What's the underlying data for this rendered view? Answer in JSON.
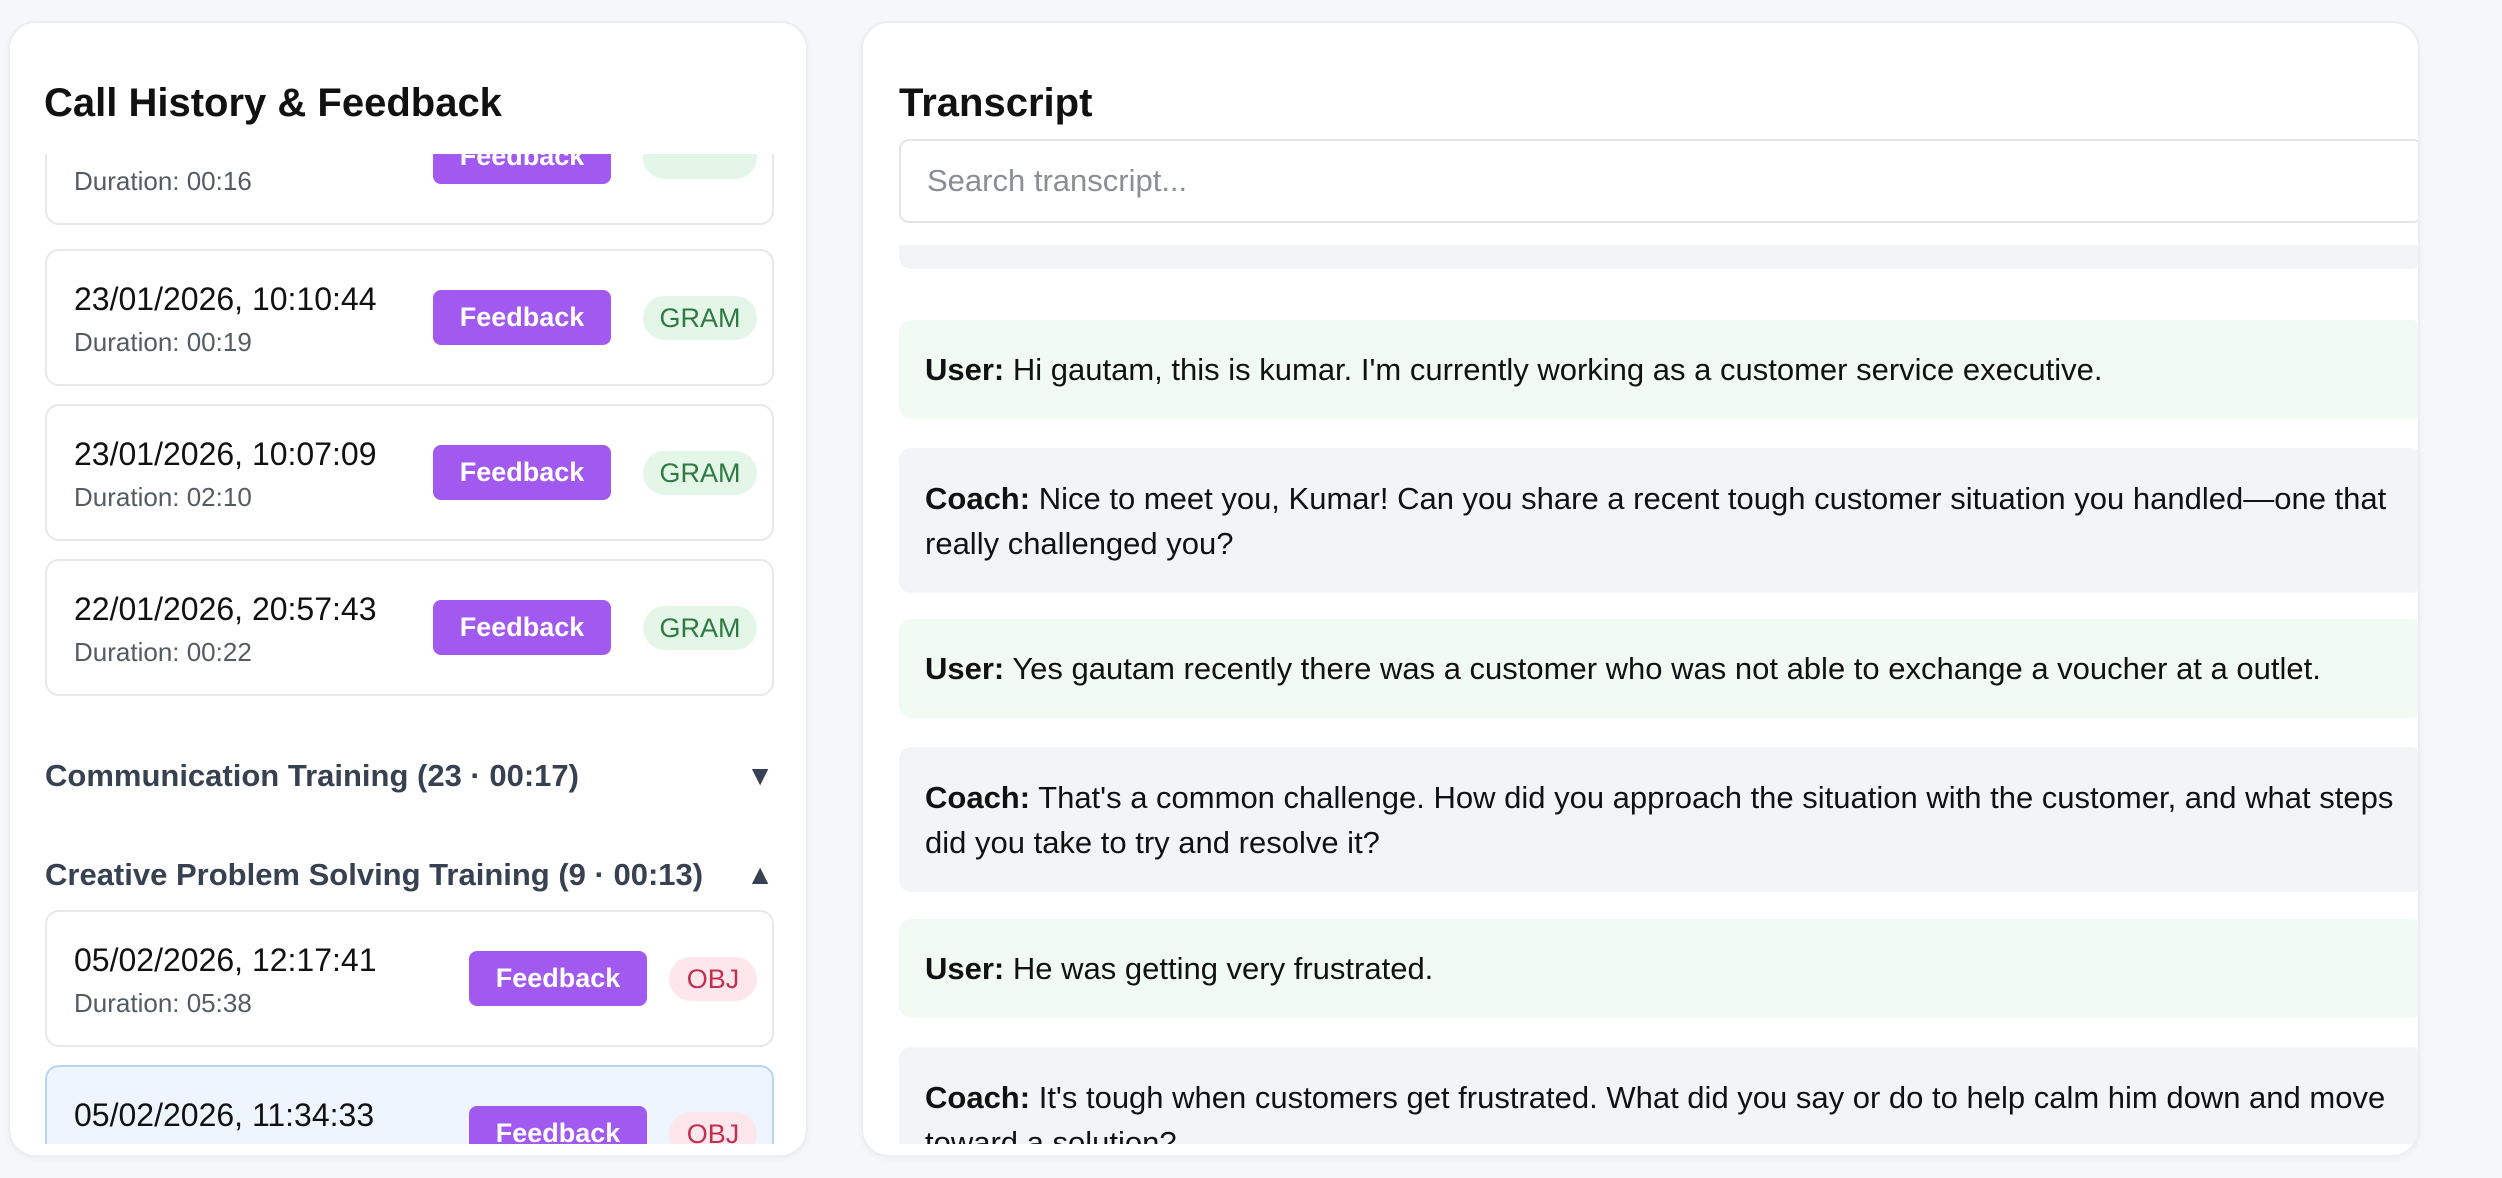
{
  "history": {
    "title": "Call History & Feedback",
    "partial_top_duration": "Duration: 00:16",
    "feedback_label": "Feedback",
    "grammar_calls": [
      {
        "date": "23/01/2026, 10:10:44",
        "duration": "Duration: 00:19",
        "tag": "GRAM"
      },
      {
        "date": "23/01/2026, 10:07:09",
        "duration": "Duration: 02:10",
        "tag": "GRAM"
      },
      {
        "date": "22/01/2026, 20:57:43",
        "duration": "Duration: 00:22",
        "tag": "GRAM"
      }
    ],
    "sections": [
      {
        "title": "Communication Training (23 · 00:17)",
        "chevron": "▼",
        "expanded": false
      },
      {
        "title": "Creative Problem Solving Training (9 · 00:13)",
        "chevron": "▲",
        "expanded": true
      }
    ],
    "creative_calls": [
      {
        "date": "05/02/2026, 12:17:41",
        "duration": "Duration: 05:38",
        "tag": "OBJ",
        "selected": false
      },
      {
        "date": "05/02/2026, 11:34:33",
        "duration": "",
        "tag": "OBJ",
        "selected": true
      }
    ]
  },
  "transcript": {
    "title": "Transcript",
    "search_placeholder": "Search transcript...",
    "messages": [
      {
        "speaker": "User:",
        "text": "Hi gautam, this is kumar. I'm currently working as a customer service executive."
      },
      {
        "speaker": "Coach:",
        "text": "Nice to meet you, Kumar! Can you share a recent tough customer situation you handled—one that really challenged you?"
      },
      {
        "speaker": "User:",
        "text": "Yes gautam recently there was a customer who was not able to exchange a voucher at a outlet."
      },
      {
        "speaker": "Coach:",
        "text": "That's a common challenge. How did you approach the situation with the customer, and what steps did you take to try and resolve it?"
      },
      {
        "speaker": "User:",
        "text": "He was getting very frustrated."
      },
      {
        "speaker": "Coach:",
        "text": "It's tough when customers get frustrated. What did you say or do to help calm him down and move toward a solution?"
      }
    ]
  },
  "colors": {
    "feedback_button": "#a259f0",
    "gram_tag_bg": "#e4f6e8",
    "gram_tag_text": "#2f7a40",
    "obj_tag_bg": "#fde6ec",
    "obj_tag_text": "#c0314f",
    "user_bubble": "#f1fbf3",
    "coach_bubble": "#f3f4f6",
    "selected_card": "#eef5fe"
  }
}
